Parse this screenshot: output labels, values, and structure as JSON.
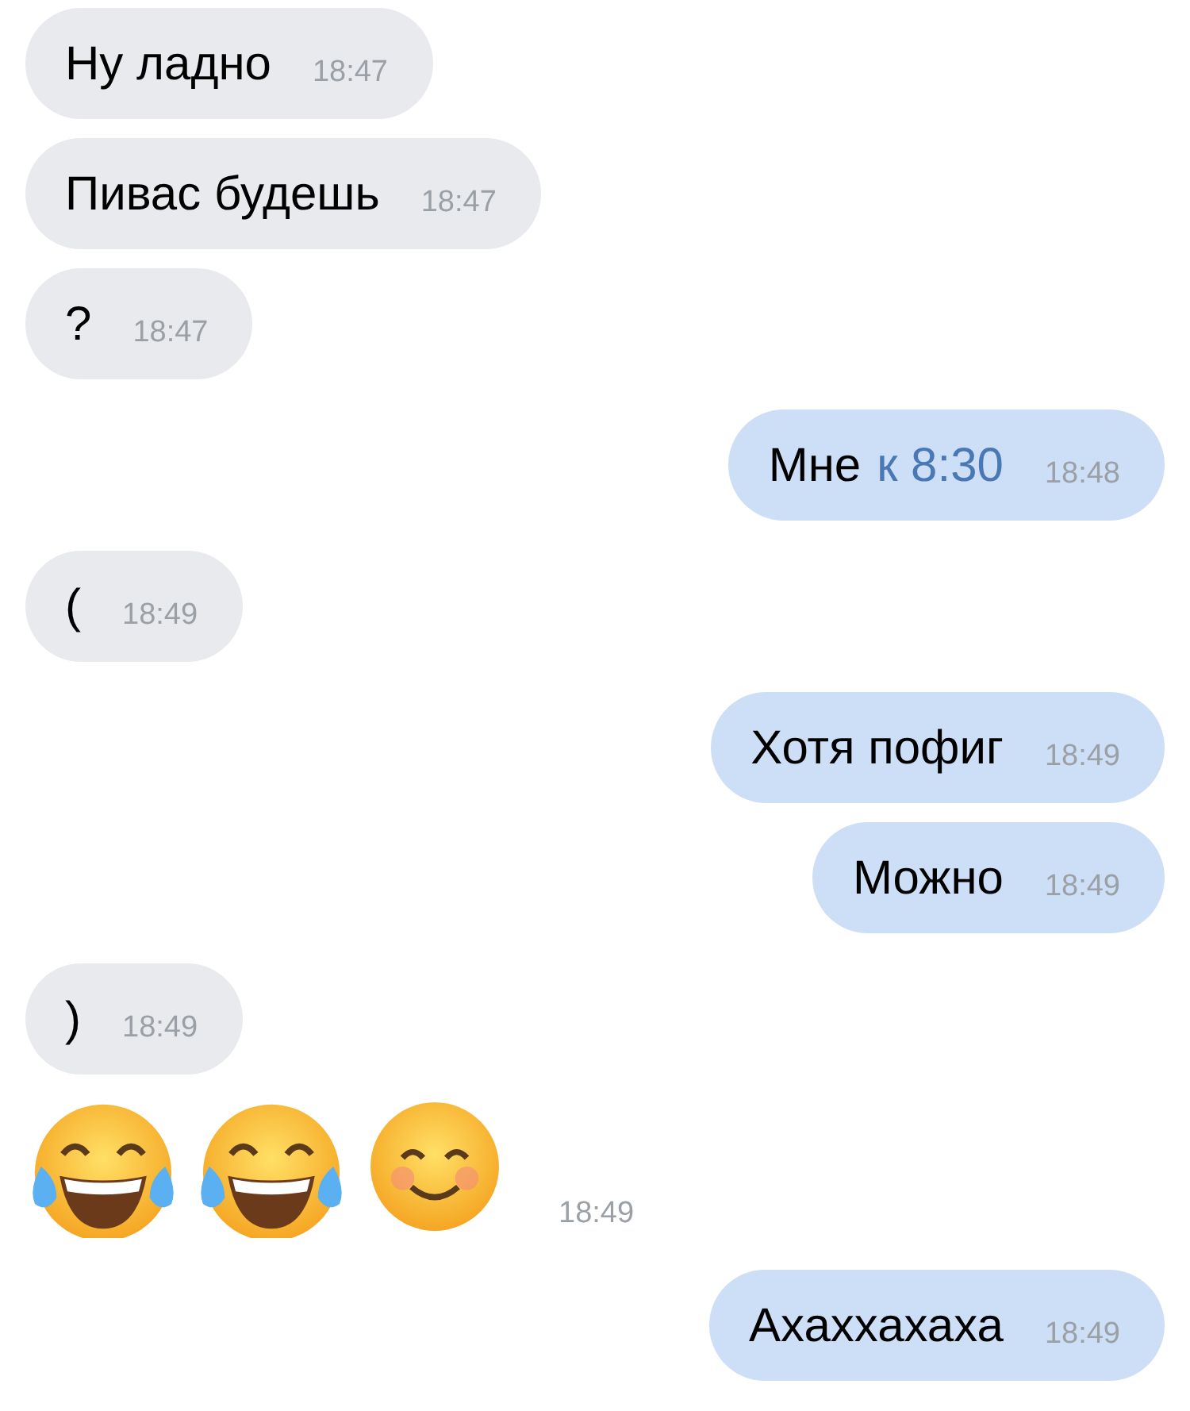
{
  "messages": [
    {
      "outgoing": false,
      "kind": "text",
      "text": "Ну ладно",
      "time": "18:47"
    },
    {
      "outgoing": false,
      "kind": "text",
      "text": "Пивас будешь",
      "time": "18:47"
    },
    {
      "outgoing": false,
      "kind": "text",
      "text": "?",
      "time": "18:47"
    },
    {
      "outgoing": true,
      "kind": "text",
      "text": "Мне",
      "link": "к 8:30",
      "time": "18:48"
    },
    {
      "outgoing": false,
      "kind": "text",
      "text": "(",
      "time": "18:49"
    },
    {
      "outgoing": true,
      "kind": "text",
      "text": "Хотя пофиг",
      "time": "18:49"
    },
    {
      "outgoing": true,
      "kind": "text",
      "text": "Можно",
      "time": "18:49"
    },
    {
      "outgoing": false,
      "kind": "text",
      "text": ")",
      "time": "18:49"
    },
    {
      "outgoing": false,
      "kind": "emoji",
      "emojis": [
        {
          "kind": "tears-of-joy"
        },
        {
          "kind": "tears-of-joy"
        },
        {
          "kind": "smile"
        }
      ],
      "time": "18:49"
    },
    {
      "outgoing": true,
      "kind": "text",
      "text": "Ахаххахаха",
      "time": "18:49"
    }
  ]
}
